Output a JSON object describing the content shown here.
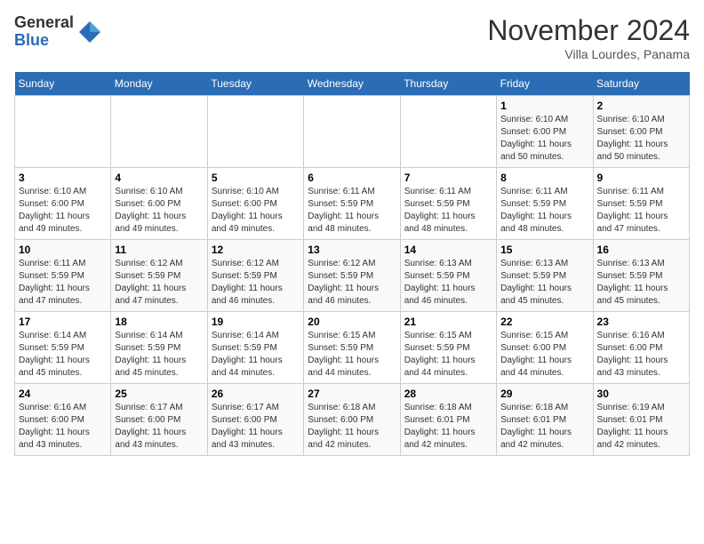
{
  "logo": {
    "general": "General",
    "blue": "Blue"
  },
  "title": "November 2024",
  "location": "Villa Lourdes, Panama",
  "days_of_week": [
    "Sunday",
    "Monday",
    "Tuesday",
    "Wednesday",
    "Thursday",
    "Friday",
    "Saturday"
  ],
  "weeks": [
    [
      {
        "day": "",
        "info": ""
      },
      {
        "day": "",
        "info": ""
      },
      {
        "day": "",
        "info": ""
      },
      {
        "day": "",
        "info": ""
      },
      {
        "day": "",
        "info": ""
      },
      {
        "day": "1",
        "info": "Sunrise: 6:10 AM\nSunset: 6:00 PM\nDaylight: 11 hours\nand 50 minutes."
      },
      {
        "day": "2",
        "info": "Sunrise: 6:10 AM\nSunset: 6:00 PM\nDaylight: 11 hours\nand 50 minutes."
      }
    ],
    [
      {
        "day": "3",
        "info": "Sunrise: 6:10 AM\nSunset: 6:00 PM\nDaylight: 11 hours\nand 49 minutes."
      },
      {
        "day": "4",
        "info": "Sunrise: 6:10 AM\nSunset: 6:00 PM\nDaylight: 11 hours\nand 49 minutes."
      },
      {
        "day": "5",
        "info": "Sunrise: 6:10 AM\nSunset: 6:00 PM\nDaylight: 11 hours\nand 49 minutes."
      },
      {
        "day": "6",
        "info": "Sunrise: 6:11 AM\nSunset: 5:59 PM\nDaylight: 11 hours\nand 48 minutes."
      },
      {
        "day": "7",
        "info": "Sunrise: 6:11 AM\nSunset: 5:59 PM\nDaylight: 11 hours\nand 48 minutes."
      },
      {
        "day": "8",
        "info": "Sunrise: 6:11 AM\nSunset: 5:59 PM\nDaylight: 11 hours\nand 48 minutes."
      },
      {
        "day": "9",
        "info": "Sunrise: 6:11 AM\nSunset: 5:59 PM\nDaylight: 11 hours\nand 47 minutes."
      }
    ],
    [
      {
        "day": "10",
        "info": "Sunrise: 6:11 AM\nSunset: 5:59 PM\nDaylight: 11 hours\nand 47 minutes."
      },
      {
        "day": "11",
        "info": "Sunrise: 6:12 AM\nSunset: 5:59 PM\nDaylight: 11 hours\nand 47 minutes."
      },
      {
        "day": "12",
        "info": "Sunrise: 6:12 AM\nSunset: 5:59 PM\nDaylight: 11 hours\nand 46 minutes."
      },
      {
        "day": "13",
        "info": "Sunrise: 6:12 AM\nSunset: 5:59 PM\nDaylight: 11 hours\nand 46 minutes."
      },
      {
        "day": "14",
        "info": "Sunrise: 6:13 AM\nSunset: 5:59 PM\nDaylight: 11 hours\nand 46 minutes."
      },
      {
        "day": "15",
        "info": "Sunrise: 6:13 AM\nSunset: 5:59 PM\nDaylight: 11 hours\nand 45 minutes."
      },
      {
        "day": "16",
        "info": "Sunrise: 6:13 AM\nSunset: 5:59 PM\nDaylight: 11 hours\nand 45 minutes."
      }
    ],
    [
      {
        "day": "17",
        "info": "Sunrise: 6:14 AM\nSunset: 5:59 PM\nDaylight: 11 hours\nand 45 minutes."
      },
      {
        "day": "18",
        "info": "Sunrise: 6:14 AM\nSunset: 5:59 PM\nDaylight: 11 hours\nand 45 minutes."
      },
      {
        "day": "19",
        "info": "Sunrise: 6:14 AM\nSunset: 5:59 PM\nDaylight: 11 hours\nand 44 minutes."
      },
      {
        "day": "20",
        "info": "Sunrise: 6:15 AM\nSunset: 5:59 PM\nDaylight: 11 hours\nand 44 minutes."
      },
      {
        "day": "21",
        "info": "Sunrise: 6:15 AM\nSunset: 5:59 PM\nDaylight: 11 hours\nand 44 minutes."
      },
      {
        "day": "22",
        "info": "Sunrise: 6:15 AM\nSunset: 6:00 PM\nDaylight: 11 hours\nand 44 minutes."
      },
      {
        "day": "23",
        "info": "Sunrise: 6:16 AM\nSunset: 6:00 PM\nDaylight: 11 hours\nand 43 minutes."
      }
    ],
    [
      {
        "day": "24",
        "info": "Sunrise: 6:16 AM\nSunset: 6:00 PM\nDaylight: 11 hours\nand 43 minutes."
      },
      {
        "day": "25",
        "info": "Sunrise: 6:17 AM\nSunset: 6:00 PM\nDaylight: 11 hours\nand 43 minutes."
      },
      {
        "day": "26",
        "info": "Sunrise: 6:17 AM\nSunset: 6:00 PM\nDaylight: 11 hours\nand 43 minutes."
      },
      {
        "day": "27",
        "info": "Sunrise: 6:18 AM\nSunset: 6:00 PM\nDaylight: 11 hours\nand 42 minutes."
      },
      {
        "day": "28",
        "info": "Sunrise: 6:18 AM\nSunset: 6:01 PM\nDaylight: 11 hours\nand 42 minutes."
      },
      {
        "day": "29",
        "info": "Sunrise: 6:18 AM\nSunset: 6:01 PM\nDaylight: 11 hours\nand 42 minutes."
      },
      {
        "day": "30",
        "info": "Sunrise: 6:19 AM\nSunset: 6:01 PM\nDaylight: 11 hours\nand 42 minutes."
      }
    ]
  ]
}
